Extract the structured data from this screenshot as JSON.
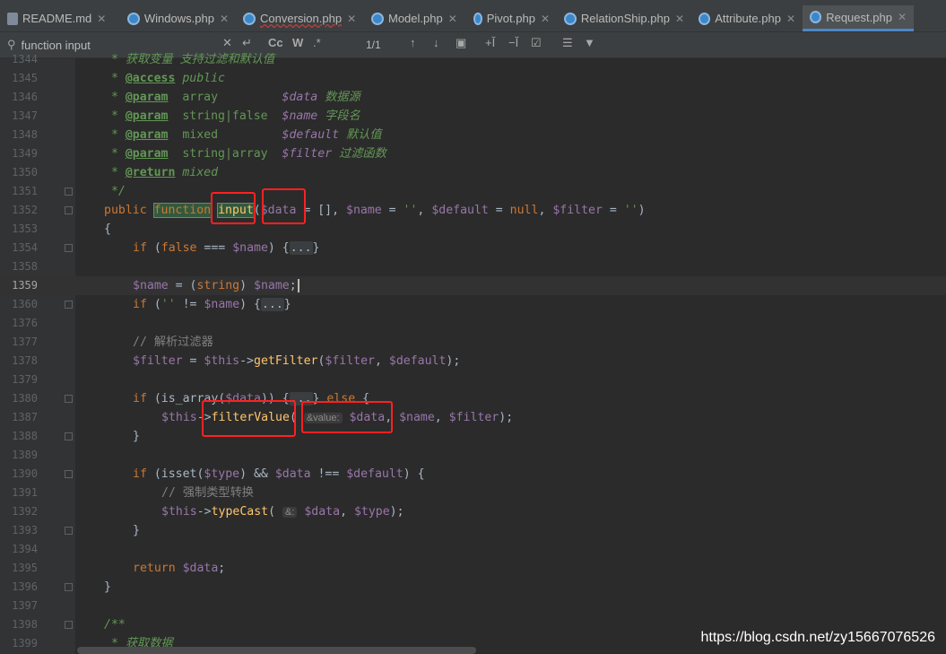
{
  "tabs": [
    {
      "label": "README.md",
      "icon": "markdown-file-icon",
      "active": false
    },
    {
      "label": "Windows.php",
      "icon": "php-class-icon",
      "active": false
    },
    {
      "label": "Conversion.php",
      "icon": "php-class-icon",
      "active": false
    },
    {
      "label": "Model.php",
      "icon": "php-class-icon",
      "active": false
    },
    {
      "label": "Pivot.php",
      "icon": "php-class-icon",
      "active": false
    },
    {
      "label": "RelationShip.php",
      "icon": "php-class-icon",
      "active": false
    },
    {
      "label": "Attribute.php",
      "icon": "php-class-icon",
      "active": false
    },
    {
      "label": "Request.php",
      "icon": "php-class-icon",
      "active": true
    }
  ],
  "search": {
    "query": "function input",
    "match_case": "Cc",
    "words": "W",
    "result_count": "1/1"
  },
  "lines": {
    "l1344": {
      "num": "1344",
      "text": "* 获取变量 支持过滤和默认值"
    },
    "l1345": {
      "num": "1345",
      "star": " * ",
      "tag": "@access",
      "rest": " public"
    },
    "l1346": {
      "num": "1346",
      "star": " * ",
      "tag": "@param",
      "t1": "  array         ",
      "v": "$data",
      "c": " 数据源"
    },
    "l1347": {
      "num": "1347",
      "star": " * ",
      "tag": "@param",
      "t1": "  string|false  ",
      "v": "$name",
      "c": " 字段名"
    },
    "l1348": {
      "num": "1348",
      "star": " * ",
      "tag": "@param",
      "t1": "  mixed         ",
      "v": "$default",
      "c": " 默认值"
    },
    "l1349": {
      "num": "1349",
      "star": " * ",
      "tag": "@param",
      "t1": "  string|array  ",
      "v": "$filter",
      "c": " 过滤函数"
    },
    "l1350": {
      "num": "1350",
      "star": " * ",
      "tag": "@return",
      "rest": " mixed"
    },
    "l1351": {
      "num": "1351",
      "text": " */"
    },
    "l1352": {
      "num": "1352",
      "kw1": "public ",
      "kw2": "function",
      "fname": "input",
      "p1": "(",
      "v1": "$data",
      "p2": " = [], ",
      "v2": "$name",
      "p3": " = ",
      "s1": "''",
      "p4": ", ",
      "v3": "$default",
      "p5": " = ",
      "kw3": "null",
      "p6": ", ",
      "v4": "$filter",
      "p7": " = ",
      "s2": "''",
      "p8": ")"
    },
    "l1353": {
      "num": "1353",
      "text": "{"
    },
    "l1354": {
      "num": "1354",
      "kw": "if ",
      "p1": "(",
      "kw2": "false",
      "p2": " === ",
      "v": "$name",
      "p3": ") {",
      "fold": "...",
      "p4": "}"
    },
    "l1358": {
      "num": "1358"
    },
    "l1359": {
      "num": "1359",
      "v1": "$name",
      "p1": " = (",
      "kw": "string",
      "p2": ") ",
      "v2": "$name",
      "p3": ";"
    },
    "l1360": {
      "num": "1360",
      "kw": "if ",
      "p1": "(",
      "s": "''",
      "p2": " != ",
      "v": "$name",
      "p3": ") {",
      "fold": "...",
      "p4": "}"
    },
    "l1376": {
      "num": "1376"
    },
    "l1377": {
      "num": "1377",
      "cmt": "// 解析过滤器"
    },
    "l1378": {
      "num": "1378",
      "v1": "$filter",
      "p1": " = ",
      "v2": "$this",
      "p2": "->",
      "fn": "getFilter",
      "p3": "(",
      "v3": "$filter",
      "p4": ", ",
      "v4": "$default",
      "p5": ");"
    },
    "l1379": {
      "num": "1379"
    },
    "l1380": {
      "num": "1380",
      "kw": "if ",
      "p1": "(is_array(",
      "v": "$data",
      "p2": ")) {",
      "fold": "...",
      "p3": "} ",
      "kw2": "else",
      "p4": " {"
    },
    "l1387": {
      "num": "1387",
      "v1": "$this",
      "p1": "->",
      "fn": "filterValue",
      "p2": "(",
      "hint": "&value:",
      "v2": " $data",
      "p3": ", ",
      "v3": "$name",
      "p4": ", ",
      "v4": "$filter",
      "p5": ");"
    },
    "l1388": {
      "num": "1388",
      "text": "}"
    },
    "l1389": {
      "num": "1389"
    },
    "l1390": {
      "num": "1390",
      "kw": "if ",
      "p1": "(isset(",
      "v1": "$type",
      "p2": ") && ",
      "v2": "$data",
      "p3": " !== ",
      "v3": "$default",
      "p4": ") {"
    },
    "l1391": {
      "num": "1391",
      "cmt": "// 强制类型转换"
    },
    "l1392": {
      "num": "1392",
      "v1": "$this",
      "p1": "->",
      "fn": "typeCast",
      "p2": "( ",
      "hint": "&:",
      "v2": " $data",
      "p3": ", ",
      "v3": "$type",
      "p4": ");"
    },
    "l1393": {
      "num": "1393",
      "text": "}"
    },
    "l1394": {
      "num": "1394"
    },
    "l1395": {
      "num": "1395",
      "kw": "return ",
      "v": "$data",
      "p1": ";"
    },
    "l1396": {
      "num": "1396",
      "text": "}"
    },
    "l1397": {
      "num": "1397"
    },
    "l1398": {
      "num": "1398",
      "text": "/**"
    },
    "l1399": {
      "num": "1399",
      "text": " * 获取数据"
    }
  },
  "watermark": "https://blog.csdn.net/zy15667076526"
}
